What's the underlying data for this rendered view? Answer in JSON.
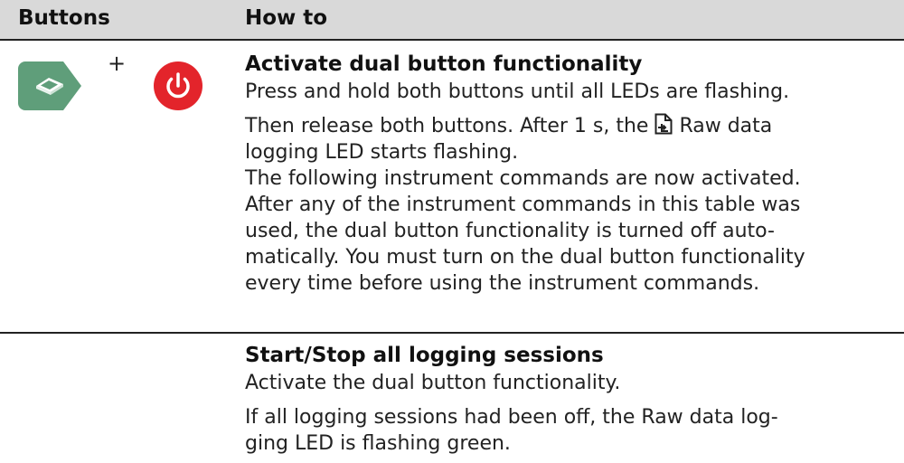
{
  "table": {
    "headers": {
      "buttons": "Buttons",
      "howto": "How to"
    },
    "row1": {
      "title": "Activate dual button functionality",
      "plus": "+",
      "p1": "Press and hold both buttons until all LEDs are flashing.",
      "p2_before": "Then release both buttons. After 1 s, the ",
      "p2_after": "Raw data",
      "p2_line2": "logging LED starts flashing.",
      "lines": [
        "The following instrument commands are now activated.",
        "After any of the instrument commands in this table was",
        "used, the dual button functionality is turned off auto-",
        "matically. You must turn on the dual button functionality",
        "every time before using the instrument commands."
      ]
    },
    "row2": {
      "title": "Start/Stop all logging sessions",
      "p1": "Activate the dual button functionality.",
      "p2_line1": "If all logging sessions had been off, the Raw data log-",
      "p2_line2": "ging LED is flashing green."
    }
  },
  "colors": {
    "gnss_button": "#5f9e7a",
    "power_button": "#e3242b",
    "header_bg": "#d9d9d9"
  },
  "icons": [
    "gnss-button-icon",
    "power-icon",
    "raw-data-logging-icon"
  ]
}
